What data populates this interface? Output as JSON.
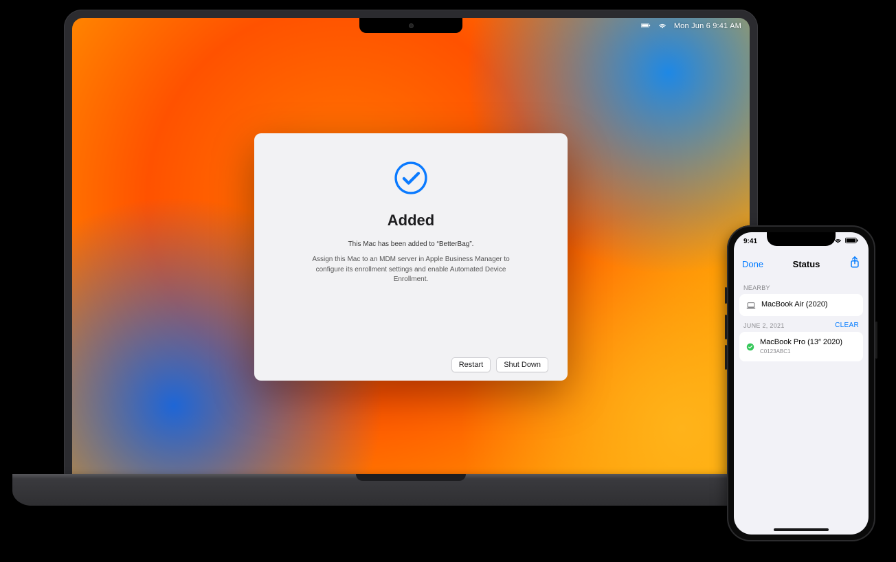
{
  "mac": {
    "menubar": {
      "clock": "Mon Jun 6   9:41 AM"
    },
    "dialog": {
      "title": "Added",
      "subtitle": "This Mac has been added to “BetterBag”.",
      "description": "Assign this Mac to an MDM server in Apple Business Manager to configure its enrollment settings and enable Automated Device Enrollment.",
      "restart": "Restart",
      "shutdown": "Shut Down"
    }
  },
  "iphone": {
    "status": {
      "time": "9:41"
    },
    "nav": {
      "done": "Done",
      "title": "Status",
      "share_icon": "share-icon"
    },
    "sections": {
      "nearby_label": "NEARBY",
      "nearby_item": {
        "title": "MacBook Air (2020)"
      },
      "history_date": "JUNE 2, 2021",
      "clear": "CLEAR",
      "history_item": {
        "title": "MacBook Pro (13″ 2020)",
        "serial": "C0123ABC1"
      }
    }
  }
}
